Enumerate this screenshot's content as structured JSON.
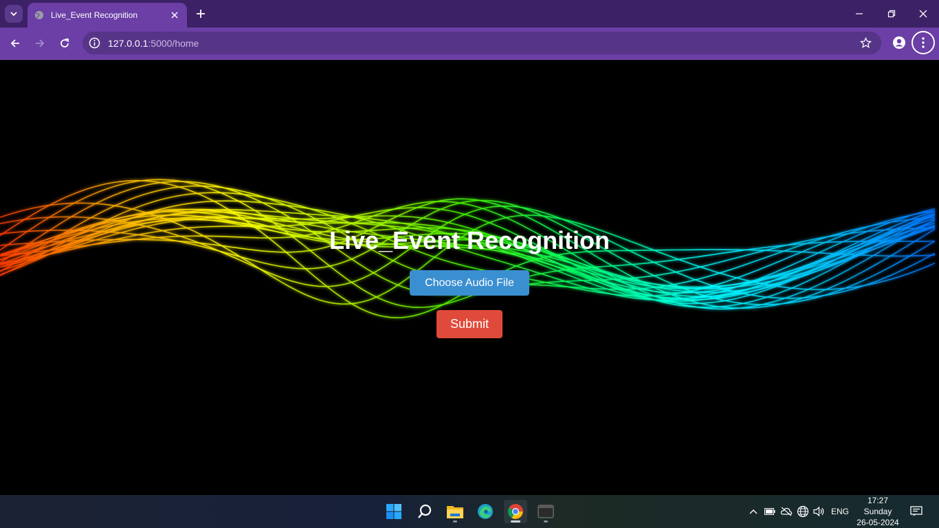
{
  "browser": {
    "tab_title": "Live_Event Recognition",
    "url_host": "127.0.0.1",
    "url_path": ":5000/home"
  },
  "page": {
    "title": "Live_Event Recognition",
    "choose_button_label": "Choose Audio File",
    "submit_button_label": "Submit"
  },
  "taskbar": {
    "language": "ENG",
    "time": "17:27",
    "day": "Sunday",
    "date": "26-05-2024",
    "apps": [
      "start-icon",
      "search-icon",
      "file-explorer-icon",
      "edge-icon",
      "chrome-icon",
      "terminal-icon"
    ]
  },
  "colors": {
    "chrome_bg": "#6b3fa5",
    "tabstrip_bg": "#3d2166",
    "choose_button": "#3a8fd1",
    "submit_button": "#e04a3a"
  }
}
